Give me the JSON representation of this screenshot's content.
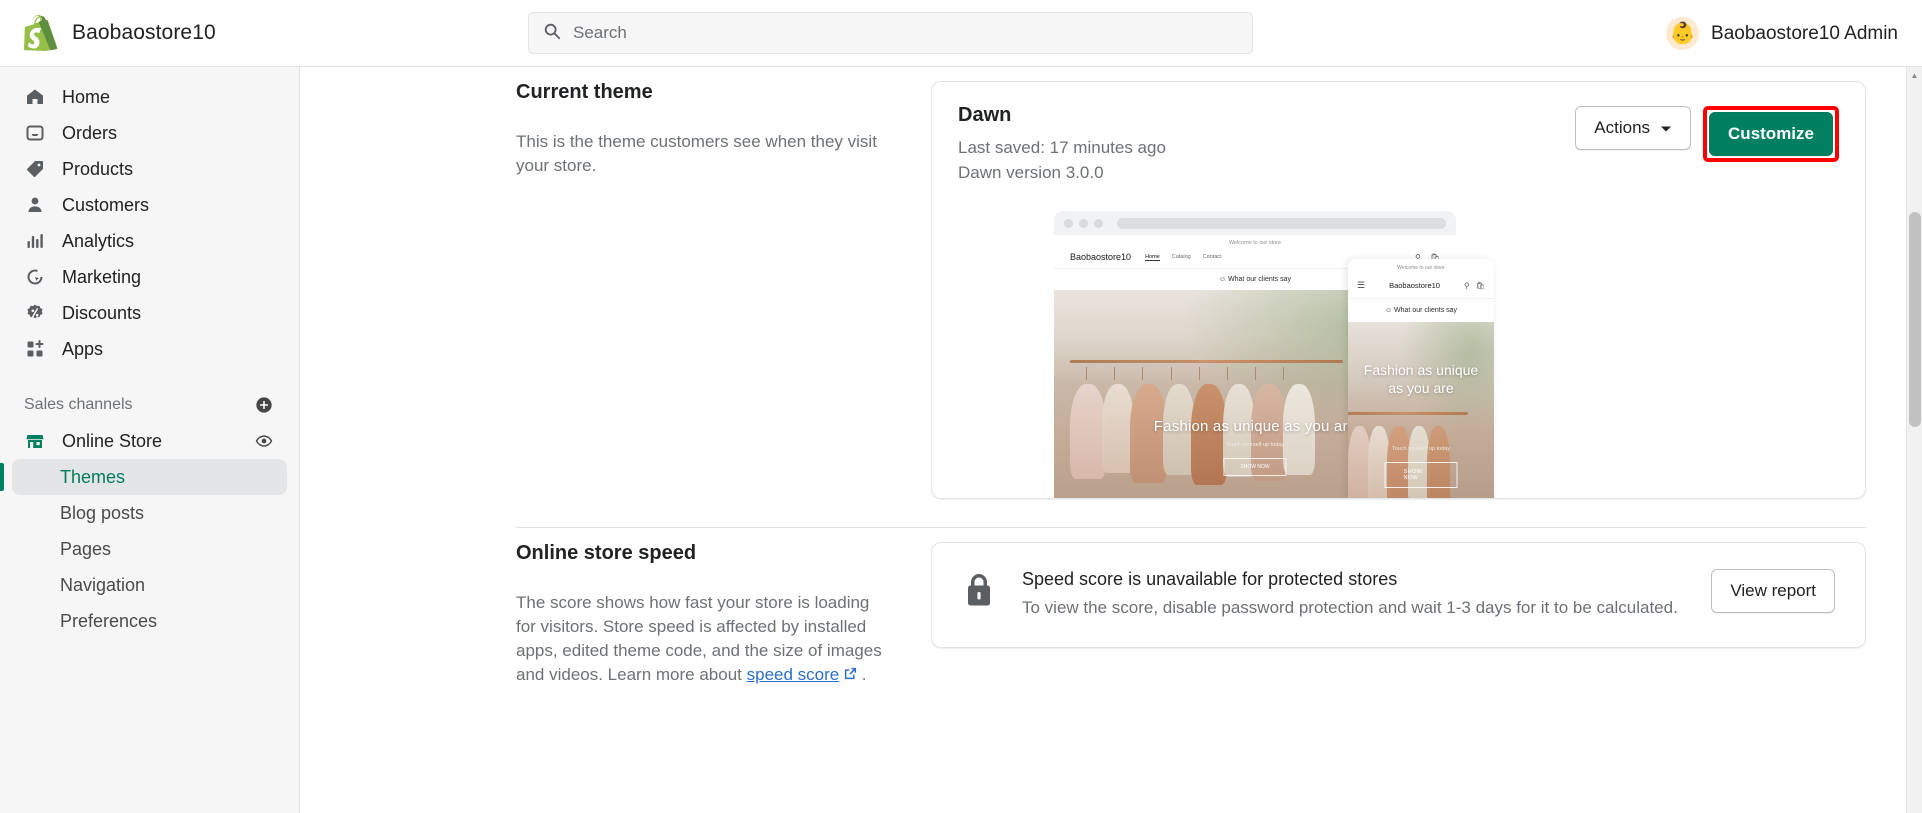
{
  "topbar": {
    "brand_name": "Baobaostore10",
    "logo_icon": "shopify-bag-icon",
    "search": {
      "placeholder": "Search",
      "value": "",
      "icon": "search-icon"
    },
    "user": {
      "name": "Baobaostore10 Admin",
      "avatar_icon": "baby-face-avatar"
    }
  },
  "sidebar": {
    "items": [
      {
        "label": "Home",
        "icon": "home-icon"
      },
      {
        "label": "Orders",
        "icon": "orders-inbox-icon"
      },
      {
        "label": "Products",
        "icon": "products-tag-icon"
      },
      {
        "label": "Customers",
        "icon": "customers-person-icon"
      },
      {
        "label": "Analytics",
        "icon": "analytics-bars-icon"
      },
      {
        "label": "Marketing",
        "icon": "marketing-target-icon"
      },
      {
        "label": "Discounts",
        "icon": "discounts-percent-icon"
      },
      {
        "label": "Apps",
        "icon": "apps-grid-icon"
      }
    ],
    "sales_channels": {
      "label": "Sales channels",
      "add_icon": "plus-circle-icon",
      "channel": {
        "label": "Online Store",
        "icon": "storefront-icon",
        "view_icon": "eye-icon"
      },
      "subitems": [
        {
          "label": "Themes",
          "active": true
        },
        {
          "label": "Blog posts",
          "active": false
        },
        {
          "label": "Pages",
          "active": false
        },
        {
          "label": "Navigation",
          "active": false
        },
        {
          "label": "Preferences",
          "active": false
        }
      ]
    }
  },
  "main": {
    "current_theme": {
      "title": "Current theme",
      "description": "This is the theme customers see when they visit your store.",
      "theme_name": "Dawn",
      "last_saved": "Last saved: 17 minutes ago",
      "version": "Dawn version 3.0.0",
      "actions_label": "Actions",
      "actions_icon": "chevron-down-icon",
      "customize_label": "Customize",
      "highlight_color": "#ff0000",
      "primary_color": "#008060"
    },
    "preview": {
      "desktop": {
        "announcement": "Welcome to our store",
        "store_name": "Baobaostore10",
        "nav_links": [
          "Home",
          "Catalog",
          "Contact"
        ],
        "search_icon": "search-icon",
        "cart_icon": "cart-icon",
        "clients_banner": "What our clients say",
        "hero_title": "Fashion as unique as you are",
        "hero_sub": "Touch yourself up today",
        "hero_button": "SHOW NOW"
      },
      "mobile": {
        "announcement": "Welcome to our store",
        "menu_icon": "hamburger-menu-icon",
        "store_name": "Baobaostore10",
        "search_icon": "search-icon",
        "cart_icon": "cart-icon",
        "clients_banner": "What our clients say",
        "hero_title": "Fashion as unique as you are",
        "hero_sub": "Touch yourself up today",
        "hero_button": "SHOW NOW"
      }
    },
    "store_speed": {
      "title": "Online store speed",
      "description_1": "The score shows how fast your store is loading for visitors. Store speed is affected by installed apps, edited theme code, and the size of images and videos. Learn more about ",
      "link_text": "speed score",
      "link_icon": "external-link-icon",
      "description_2": " .",
      "panel": {
        "lock_icon": "lock-icon",
        "headline": "Speed score is unavailable for protected stores",
        "body": "To view the score, disable password protection and wait 1-3 days for it to be calculated.",
        "button_label": "View report"
      }
    }
  },
  "scrollbar": {
    "up_icon": "scroll-up-arrow",
    "down_icon": "scroll-down-arrow"
  }
}
